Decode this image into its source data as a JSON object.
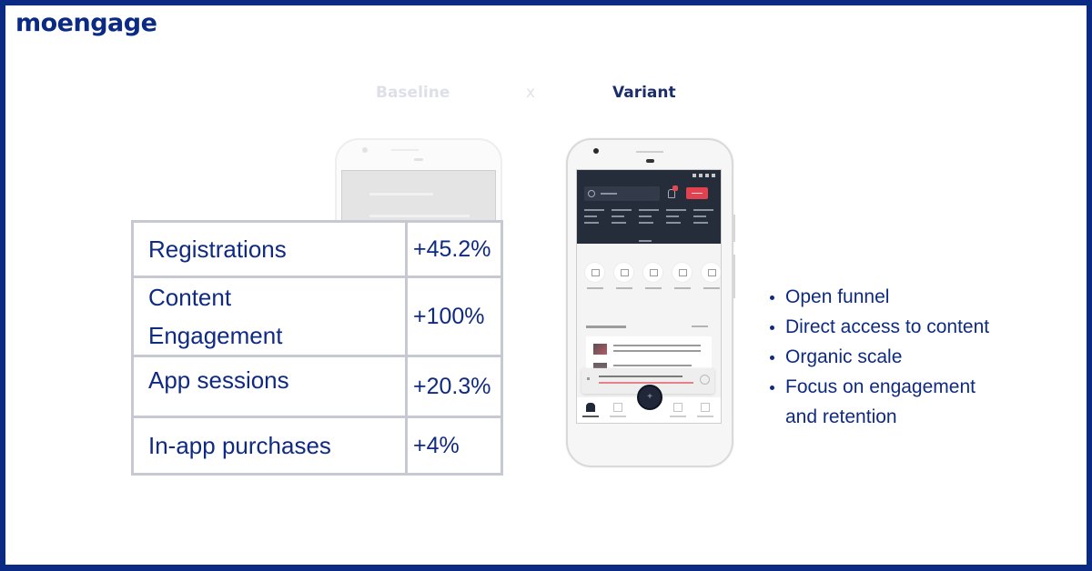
{
  "brand": {
    "logo_text": "moengage",
    "color": "#0a2a84",
    "text_color": "#0f2a82"
  },
  "comparison": {
    "baseline_label": "Baseline",
    "separator": "x",
    "variant_label": "Variant"
  },
  "metrics": [
    {
      "label": "Registrations",
      "value": "+45.2%"
    },
    {
      "label": "Content\nEngagement",
      "label_lines": [
        "Content",
        "Engagement"
      ],
      "value": "+100%"
    },
    {
      "label": "App sessions",
      "value": "+20.3%"
    },
    {
      "label": "In-app purchases",
      "value": "+4%"
    }
  ],
  "benefits": [
    "Open funnel",
    "Direct access to content",
    "Organic scale",
    "Focus on engagement and retention"
  ],
  "benefits_display": {
    "line4a": "Focus on engagement",
    "line4b": "and retention"
  },
  "variant_phone": {
    "icons": [
      "search-icon",
      "bell-icon",
      "folder-icon",
      "exchange-icon",
      "news-icon",
      "chart-icon",
      "play-icon",
      "home-icon",
      "add-icon"
    ],
    "accent_color": "#e0434f",
    "header_color": "#262d3a"
  }
}
